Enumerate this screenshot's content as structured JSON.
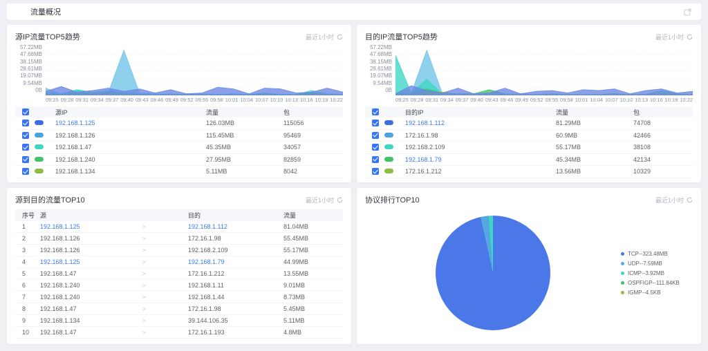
{
  "page": {
    "title": "流量概况"
  },
  "panels": {
    "source_trend": {
      "title": "源IP流量TOP5趋势",
      "time_range": "最近1小时",
      "headers": {
        "ip": "源IP",
        "traffic": "流量",
        "packets": "包"
      },
      "rows": [
        {
          "color": "#3d6ee0",
          "ip": "192.168.1.125",
          "link": true,
          "traffic": "126.03MB",
          "packets": "115056"
        },
        {
          "color": "#4ba4dc",
          "ip": "192.168.1.126",
          "link": false,
          "traffic": "115.45MB",
          "packets": "95469"
        },
        {
          "color": "#3fd6c5",
          "ip": "192.168.1.47",
          "link": false,
          "traffic": "45.35MB",
          "packets": "34057"
        },
        {
          "color": "#42c368",
          "ip": "192.168.1.240",
          "link": false,
          "traffic": "27.95MB",
          "packets": "82859"
        },
        {
          "color": "#8fbc42",
          "ip": "192.168.1.134",
          "link": false,
          "traffic": "5.11MB",
          "packets": "8042"
        }
      ]
    },
    "dest_trend": {
      "title": "目的IP流量TOP5趋势",
      "time_range": "最近1小时",
      "headers": {
        "ip": "目的IP",
        "traffic": "流量",
        "packets": "包"
      },
      "rows": [
        {
          "color": "#3d6ee0",
          "ip": "192.168.1.112",
          "link": true,
          "traffic": "81.29MB",
          "packets": "74708"
        },
        {
          "color": "#4ba4dc",
          "ip": "172.16.1.98",
          "link": false,
          "traffic": "60.9MB",
          "packets": "42466"
        },
        {
          "color": "#3fd6c5",
          "ip": "192.168.2.109",
          "link": false,
          "traffic": "55.17MB",
          "packets": "38108"
        },
        {
          "color": "#42c368",
          "ip": "192.168.1.79",
          "link": true,
          "traffic": "45.34MB",
          "packets": "42134"
        },
        {
          "color": "#8fbc42",
          "ip": "172.16.1.212",
          "link": false,
          "traffic": "13.56MB",
          "packets": "10329"
        }
      ]
    },
    "src_dst_top10": {
      "title": "源到目的流量TOP10",
      "time_range": "最近1小时",
      "headers": {
        "index": "序号",
        "src": "源",
        "dst": "目的",
        "traffic": "流量"
      },
      "arrow": ">",
      "rows": [
        {
          "no": "1",
          "src": "192.168.1.125",
          "src_link": true,
          "dst": "192.168.1.112",
          "dst_link": true,
          "traffic": "81.04MB"
        },
        {
          "no": "2",
          "src": "192.168.1.126",
          "src_link": false,
          "dst": "172.16.1.98",
          "dst_link": false,
          "traffic": "55.45MB"
        },
        {
          "no": "3",
          "src": "192.168.1.126",
          "src_link": false,
          "dst": "192.168.2.109",
          "dst_link": false,
          "traffic": "55.17MB"
        },
        {
          "no": "4",
          "src": "192.168.1.125",
          "src_link": true,
          "dst": "192.168.1.79",
          "dst_link": true,
          "traffic": "44.99MB"
        },
        {
          "no": "5",
          "src": "192.168.1.47",
          "src_link": false,
          "dst": "172.16.1.212",
          "dst_link": false,
          "traffic": "13.55MB"
        },
        {
          "no": "6",
          "src": "192.168.1.240",
          "src_link": false,
          "dst": "192.168.1.11",
          "dst_link": false,
          "traffic": "9.01MB"
        },
        {
          "no": "7",
          "src": "192.168.1.240",
          "src_link": false,
          "dst": "192.168.1.44",
          "dst_link": false,
          "traffic": "8.73MB"
        },
        {
          "no": "8",
          "src": "192.168.1.47",
          "src_link": false,
          "dst": "172.16.1.98",
          "dst_link": false,
          "traffic": "5.45MB"
        },
        {
          "no": "9",
          "src": "192.168.1.134",
          "src_link": false,
          "dst": "39.144.106.35",
          "dst_link": false,
          "traffic": "5.11MB"
        },
        {
          "no": "10",
          "src": "192.168.1.47",
          "src_link": false,
          "dst": "172.16.1.193",
          "dst_link": false,
          "traffic": "4.8MB"
        }
      ]
    },
    "protocol_top10": {
      "title": "协议排行TOP10",
      "time_range": "最近1小时"
    }
  },
  "chart_data": [
    {
      "type": "area",
      "title": "源IP流量TOP5趋势",
      "x": [
        "09:25",
        "09:28",
        "09:31",
        "09:34",
        "09:37",
        "09:40",
        "09:43",
        "09:46",
        "09:49",
        "09:52",
        "09:55",
        "09:58",
        "10:01",
        "10:04",
        "10:07",
        "10:10",
        "10:13",
        "10:16",
        "10:19",
        "10:22"
      ],
      "ylabels": [
        "57.22MB",
        "47.68MB",
        "38.15MB",
        "28.61MB",
        "19.07MB",
        "9.54MB",
        "0B"
      ],
      "ymax_mb": 60,
      "grid": true,
      "series": [
        {
          "name": "192.168.1.126",
          "color": "#6fc3e8",
          "values": [
            9,
            2,
            6,
            2,
            3,
            56,
            3,
            2,
            1,
            1,
            1,
            1,
            1,
            1,
            1,
            1,
            1,
            2,
            1,
            1
          ]
        },
        {
          "name": "192.168.1.47",
          "color": "#3fd6c5",
          "values": [
            3,
            2,
            7,
            4,
            6,
            3,
            2,
            1,
            2,
            1,
            2,
            1,
            2,
            1,
            3,
            1,
            1,
            6,
            2,
            1
          ]
        },
        {
          "name": "192.168.1.240",
          "color": "#42c368",
          "values": [
            2,
            1,
            3,
            2,
            4,
            2,
            1,
            1,
            1,
            1,
            1,
            1,
            1,
            1,
            2,
            1,
            1,
            3,
            1,
            1
          ]
        },
        {
          "name": "192.168.1.134",
          "color": "#8fbc42",
          "values": [
            1,
            1,
            1,
            1,
            2,
            1,
            1,
            0,
            1,
            0,
            1,
            0,
            1,
            0,
            1,
            0,
            1,
            1,
            1,
            0
          ]
        },
        {
          "name": "192.168.1.125",
          "color": "#6a88e4",
          "values": [
            5,
            11,
            4,
            6,
            9,
            5,
            8,
            3,
            7,
            2,
            3,
            10,
            8,
            2,
            9,
            8,
            3,
            4,
            9,
            4
          ]
        }
      ]
    },
    {
      "type": "area",
      "title": "目的IP流量TOP5趋势",
      "x": [
        "09:25",
        "09:28",
        "09:31",
        "09:34",
        "09:37",
        "09:40",
        "09:43",
        "09:46",
        "09:49",
        "09:52",
        "09:55",
        "09:58",
        "10:01",
        "10:04",
        "10:07",
        "10:10",
        "10:13",
        "10:16",
        "10:19",
        "10:22"
      ],
      "ylabels": [
        "57.22MB",
        "47.68MB",
        "38.15MB",
        "28.61MB",
        "19.07MB",
        "9.54MB",
        "0B"
      ],
      "ymax_mb": 60,
      "grid": true,
      "series": [
        {
          "name": "172.16.1.98",
          "color": "#6fc3e8",
          "values": [
            3,
            2,
            56,
            2,
            1,
            1,
            2,
            1,
            1,
            1,
            1,
            1,
            1,
            1,
            1,
            1,
            1,
            1,
            1,
            1
          ]
        },
        {
          "name": "192.168.2.109",
          "color": "#3fd6c5",
          "values": [
            50,
            3,
            20,
            2,
            1,
            1,
            1,
            1,
            2,
            1,
            1,
            1,
            1,
            1,
            2,
            1,
            1,
            2,
            1,
            1
          ]
        },
        {
          "name": "192.168.1.79",
          "color": "#42c368",
          "values": [
            2,
            2,
            8,
            3,
            2,
            2,
            7,
            2,
            1,
            1,
            2,
            1,
            1,
            1,
            2,
            1,
            1,
            6,
            2,
            1
          ]
        },
        {
          "name": "172.16.1.212",
          "color": "#8fbc42",
          "values": [
            1,
            1,
            3,
            4,
            1,
            1,
            1,
            1,
            1,
            1,
            1,
            1,
            1,
            1,
            1,
            1,
            1,
            2,
            1,
            1
          ]
        },
        {
          "name": "192.168.1.112",
          "color": "#6a88e4",
          "values": [
            2,
            12,
            6,
            3,
            9,
            2,
            3,
            9,
            2,
            5,
            6,
            3,
            7,
            6,
            8,
            2,
            6,
            8,
            3,
            5
          ]
        }
      ]
    },
    {
      "type": "pie",
      "title": "协议排行TOP10",
      "legend_position": "right",
      "slices": [
        {
          "label": "TCP",
          "display": "TCP--323.48MB",
          "value_mb": 323.48,
          "color": "#4a78e8"
        },
        {
          "label": "UDP",
          "display": "UDP--7.59MB",
          "value_mb": 7.59,
          "color": "#54a8e0"
        },
        {
          "label": "ICMP",
          "display": "ICMP--3.92MB",
          "value_mb": 3.92,
          "color": "#3fd6c5"
        },
        {
          "label": "OSPFIGP",
          "display": "OSPFIGP--111.84KB",
          "value_mb": 0.1092,
          "color": "#42c368"
        },
        {
          "label": "IGMP",
          "display": "IGMP--4.5KB",
          "value_mb": 0.0044,
          "color": "#8fbc42"
        }
      ]
    }
  ]
}
